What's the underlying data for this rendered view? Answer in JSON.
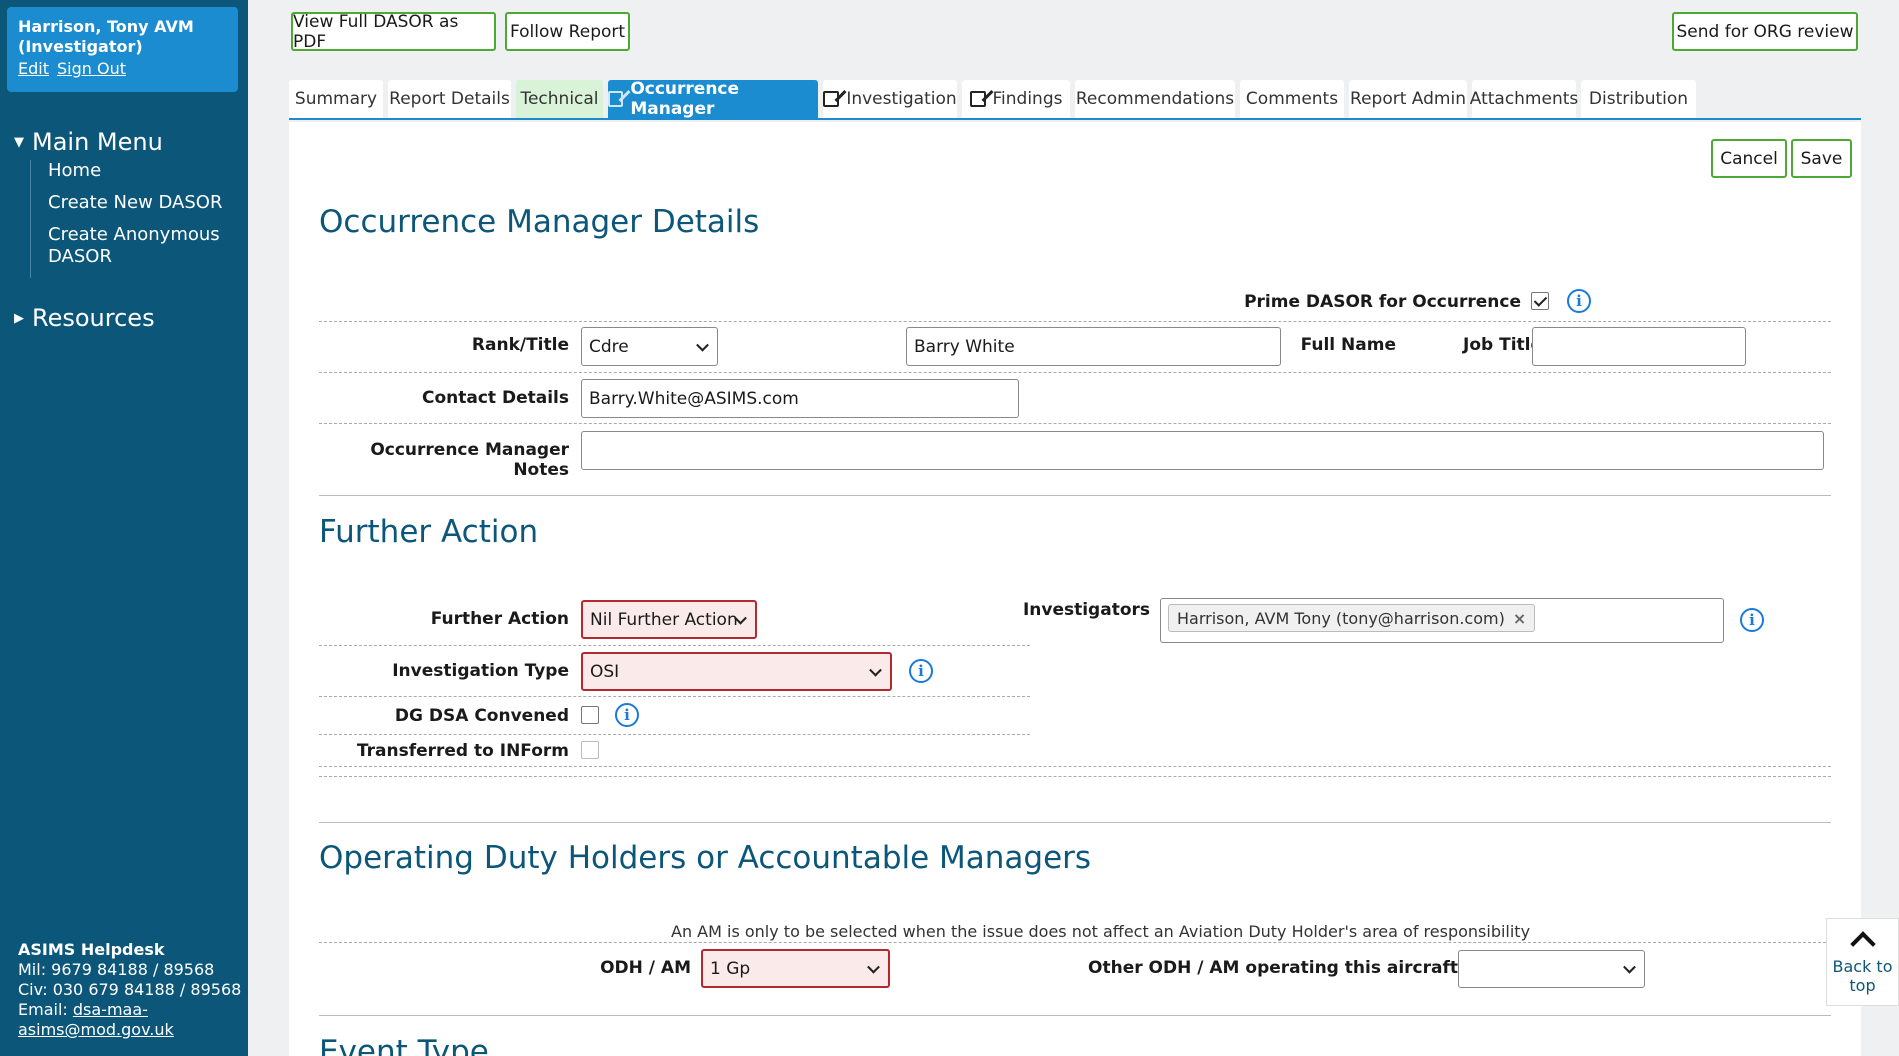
{
  "user": {
    "name": "Harrison, Tony AVM",
    "role": "(Investigator)",
    "edit": "Edit",
    "signout": "Sign Out"
  },
  "menu": {
    "main_title": "Main Menu",
    "items": [
      "Home",
      "Create New DASOR",
      "Create Anonymous DASOR"
    ],
    "resources_title": "Resources"
  },
  "helpdesk": {
    "title": "ASIMS Helpdesk",
    "mil": "Mil: 9679 84188 / 89568",
    "civ": "Civ: 030 679 84188 / 89568",
    "email_label": "Email: ",
    "email_1": "dsa-maa-",
    "email_2": "asims@mod.gov.uk"
  },
  "toolbar": {
    "pdf": "View Full DASOR as PDF",
    "follow": "Follow Report",
    "send": "Send for ORG review"
  },
  "tabs": [
    "Summary",
    "Report Details",
    "Technical",
    "Occurrence Manager",
    "Investigation",
    "Findings",
    "Recommendations",
    "Comments",
    "Report Admin",
    "Attachments",
    "Distribution"
  ],
  "actions": {
    "cancel": "Cancel",
    "save": "Save"
  },
  "om": {
    "heading": "Occurrence Manager Details",
    "prime_label": "Prime DASOR for Occurrence",
    "rank_label": "Rank/Title",
    "rank_value": "Cdre",
    "fullname_label": "Full Name",
    "fullname_value": "Barry White",
    "jobtitle_label": "Job Title",
    "jobtitle_value": "",
    "contact_label": "Contact Details",
    "contact_value": "Barry.White@ASIMS.com",
    "notes_label": "Occurrence Manager Notes",
    "notes_value": ""
  },
  "fa": {
    "heading": "Further Action",
    "further_label": "Further Action",
    "further_value": "Nil Further Action",
    "invtype_label": "Investigation Type",
    "invtype_value": "OSI",
    "dgdsa_label": "DG DSA Convened",
    "inform_label": "Transferred to INForm",
    "investigators_label": "Investigators",
    "investigator_token": "Harrison, AVM Tony (tony@harrison.com)",
    "token_remove": "×"
  },
  "odh": {
    "heading": "Operating Duty Holders or Accountable Managers",
    "note": "An AM is only to be selected when the issue does not affect an Aviation Duty Holder's area of responsibility",
    "odh_label": "ODH / AM",
    "odh_value": "1 Gp",
    "other_label": "Other ODH / AM operating this aircraft",
    "other_value": ""
  },
  "next_heading": "Event Type",
  "backtop": {
    "line1": "Back to",
    "line2": "top"
  },
  "info_glyph": "i"
}
